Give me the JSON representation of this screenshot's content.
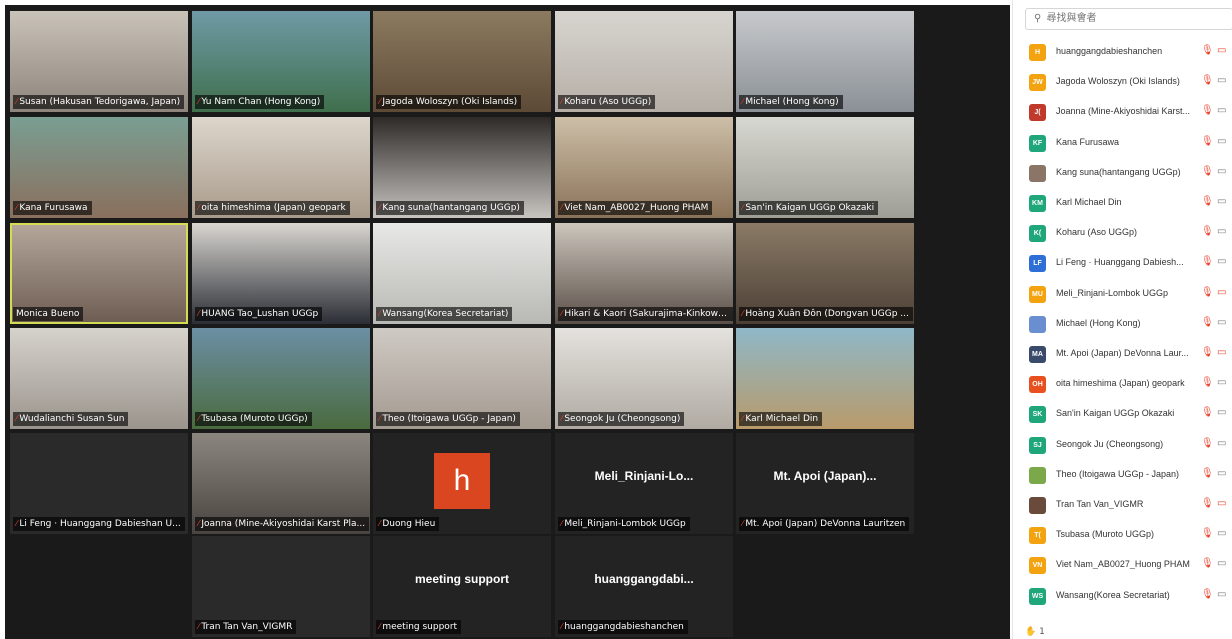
{
  "gallery": {
    "tiles": [
      {
        "name": "Susan (Hakusan Tedorigawa, Japan)",
        "bg1": "#c9c2b8",
        "bg2": "#8d857c"
      },
      {
        "name": "Yu Nam Chan (Hong Kong)",
        "bg1": "#6f9aa6",
        "bg2": "#3f6f4c"
      },
      {
        "name": "Jagoda Woloszyn (Oki Islands)",
        "bg1": "#8c7a60",
        "bg2": "#5c4a36"
      },
      {
        "name": "Koharu (Aso UGGp)",
        "bg1": "#d8d5d0",
        "bg2": "#b5aea6"
      },
      {
        "name": "Michael (Hong Kong)",
        "bg1": "#c7c9cc",
        "bg2": "#8a9096"
      },
      {
        "name": "Kana Furusawa",
        "bg1": "#7a9e93",
        "bg2": "#8a6f5d"
      },
      {
        "name": "oita himeshima (Japan) geopark",
        "bg1": "#ddd6cc",
        "bg2": "#a89a8a"
      },
      {
        "name": "Kang suna(hantangang UGGp)",
        "bg1": "#2e2a28",
        "bg2": "#c8c4c0"
      },
      {
        "name": "Viet Nam_AB0027_Huong PHAM",
        "bg1": "#cdbfa8",
        "bg2": "#8a7258"
      },
      {
        "name": "San'in Kaigan UGGp Okazaki",
        "bg1": "#d8d8d2",
        "bg2": "#9e9e96"
      },
      {
        "name": "Monica Bueno",
        "bg1": "#b5a89b",
        "bg2": "#6d5c52"
      },
      {
        "name": "HUANG Tao_Lushan UGGp",
        "bg1": "#d9d6d0",
        "bg2": "#2b2e36"
      },
      {
        "name": "Wansang(Korea Secretariat)",
        "bg1": "#e8e8e6",
        "bg2": "#b8b8b4"
      },
      {
        "name": "Hikari & Kaori (Sakurajima-Kinkowa...",
        "bg1": "#ccc6bd",
        "bg2": "#5a4f48"
      },
      {
        "name": "Hoàng Xuân Đôn (Dongvan UGGp ...",
        "bg1": "#8a7a66",
        "bg2": "#4c4036"
      },
      {
        "name": "Wudalianchi Susan Sun",
        "bg1": "#d6d2cc",
        "bg2": "#9a948c"
      },
      {
        "name": "Tsubasa (Muroto UGGp)",
        "bg1": "#6c8fa5",
        "bg2": "#4a6b3e"
      },
      {
        "name": "Theo (Itoigawa UGGp - Japan)",
        "bg1": "#cfcac4",
        "bg2": "#a39a90"
      },
      {
        "name": "Seongok Ju (Cheongsong)",
        "bg1": "#e4e2de",
        "bg2": "#b0aaa2"
      },
      {
        "name": "Karl Michael Din",
        "bg1": "#8fb8c8",
        "bg2": "#b89a6a"
      },
      {
        "name": "Li Feng · Huanggang Dabieshan U...",
        "bg1": "#2a2a2a",
        "bg2": "#2a2a2a"
      },
      {
        "name": "Joanna (Mine-Akiyoshidai Karst Pla...",
        "bg1": "#8c8680",
        "bg2": "#4a4440"
      },
      {
        "name": "Duong Hieu",
        "big": "h"
      },
      {
        "name": "Meli_Rinjani-Lombok UGGp",
        "big_text": "Meli_Rinjani-Lo..."
      },
      {
        "name": "Mt. Apoi (Japan) DeVonna Lauritzen",
        "big_text": "Mt. Apoi (Japan)..."
      },
      {
        "name": "Tran Tan Van_VIGMR",
        "bg1": "#2a2a2a",
        "bg2": "#2a2a2a"
      },
      {
        "name": "meeting support",
        "big_text": "meeting support"
      },
      {
        "name": "huanggangdabieshanchen",
        "big_text": "huanggangdabi..."
      }
    ]
  },
  "panel": {
    "search_placeholder": "尋找與會者",
    "participants": [
      {
        "initials": "H",
        "color": "#f2a30f",
        "name": "huanggangdabieshanchen",
        "cam_off": true
      },
      {
        "initials": "JW",
        "color": "#f2a30f",
        "name": "Jagoda Woloszyn (Oki Islands)",
        "cam_off": false
      },
      {
        "initials": "J(",
        "color": "#c0392b",
        "name": "Joanna (Mine-Akiyoshidai Karst...",
        "cam_off": false
      },
      {
        "initials": "KF",
        "color": "#1fa67a",
        "name": "Kana Furusawa",
        "cam_off": false
      },
      {
        "initials": "",
        "color": "#8a7566",
        "name": "Kang suna(hantangang UGGp)",
        "cam_off": false
      },
      {
        "initials": "KM",
        "color": "#1fa67a",
        "name": "Karl Michael Din",
        "cam_off": false
      },
      {
        "initials": "K(",
        "color": "#1fa67a",
        "name": "Koharu (Aso UGGp)",
        "cam_off": false
      },
      {
        "initials": "LF",
        "color": "#2d6fd6",
        "name": "Li Feng · Huanggang Dabiesh...",
        "cam_off": false
      },
      {
        "initials": "MU",
        "color": "#f2a30f",
        "name": "Meli_Rinjani-Lombok UGGp",
        "cam_off": true
      },
      {
        "initials": "",
        "color": "#6a8fd0",
        "name": "Michael (Hong Kong)",
        "cam_off": false
      },
      {
        "initials": "MA",
        "color": "#3a4a6b",
        "name": "Mt. Apoi (Japan) DeVonna Laur...",
        "cam_off": true
      },
      {
        "initials": "OH",
        "color": "#e8501f",
        "name": "oita himeshima (Japan) geopark",
        "cam_off": false
      },
      {
        "initials": "SK",
        "color": "#1fa67a",
        "name": "San'in Kaigan UGGp Okazaki",
        "cam_off": false
      },
      {
        "initials": "SJ",
        "color": "#1fa67a",
        "name": "Seongok Ju (Cheongsong)",
        "cam_off": false
      },
      {
        "initials": "",
        "color": "#7aa84a",
        "name": "Theo (Itoigawa UGGp - Japan)",
        "cam_off": false
      },
      {
        "initials": "",
        "color": "#6a4a3a",
        "name": "Tran Tan Van_VIGMR",
        "cam_off": true
      },
      {
        "initials": "T(",
        "color": "#f2a30f",
        "name": "Tsubasa (Muroto UGGp)",
        "cam_off": false
      },
      {
        "initials": "VN",
        "color": "#f2a30f",
        "name": "Viet Nam_AB0027_Huong PHAM",
        "cam_off": false
      },
      {
        "initials": "WS",
        "color": "#1fa67a",
        "name": "Wansang(Korea Secretariat)",
        "cam_off": false
      }
    ],
    "raised_hands": "1"
  }
}
